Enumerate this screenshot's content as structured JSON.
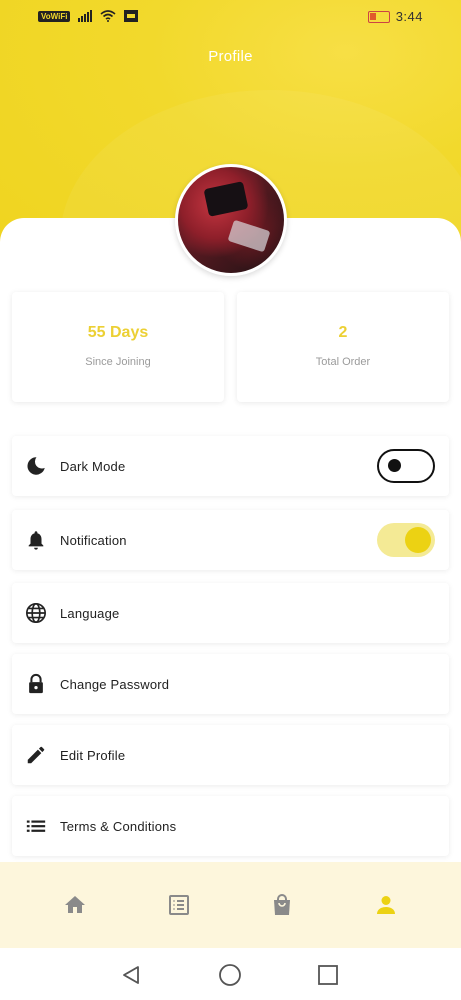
{
  "status_bar": {
    "network_badge": "VoWiFi",
    "time": "3:44"
  },
  "header": {
    "title": "Profile"
  },
  "stats": [
    {
      "value": "55 Days",
      "label": "Since Joining"
    },
    {
      "value": "2",
      "label": "Total Order"
    }
  ],
  "settings": {
    "dark_mode": {
      "label": "Dark Mode",
      "icon": "moon-icon",
      "enabled": false
    },
    "notification": {
      "label": "Notification",
      "icon": "bell-icon",
      "enabled": true
    },
    "language": {
      "label": "Language",
      "icon": "globe-icon"
    },
    "change_password": {
      "label": "Change Password",
      "icon": "lock-icon"
    },
    "edit_profile": {
      "label": "Edit Profile",
      "icon": "pencil-icon"
    },
    "terms": {
      "label": "Terms & Conditions",
      "icon": "list-icon"
    }
  },
  "bottom_nav": [
    {
      "name": "home",
      "icon": "home-icon",
      "active": false
    },
    {
      "name": "orders",
      "icon": "list-box-icon",
      "active": false
    },
    {
      "name": "cart",
      "icon": "shopping-bag-icon",
      "active": false
    },
    {
      "name": "profile",
      "icon": "person-icon",
      "active": true
    }
  ],
  "colors": {
    "accent": "#ecd213",
    "header": "#f2d92c",
    "nav_bg": "#fdf6dc",
    "nav_inactive": "#8a8a8a"
  }
}
